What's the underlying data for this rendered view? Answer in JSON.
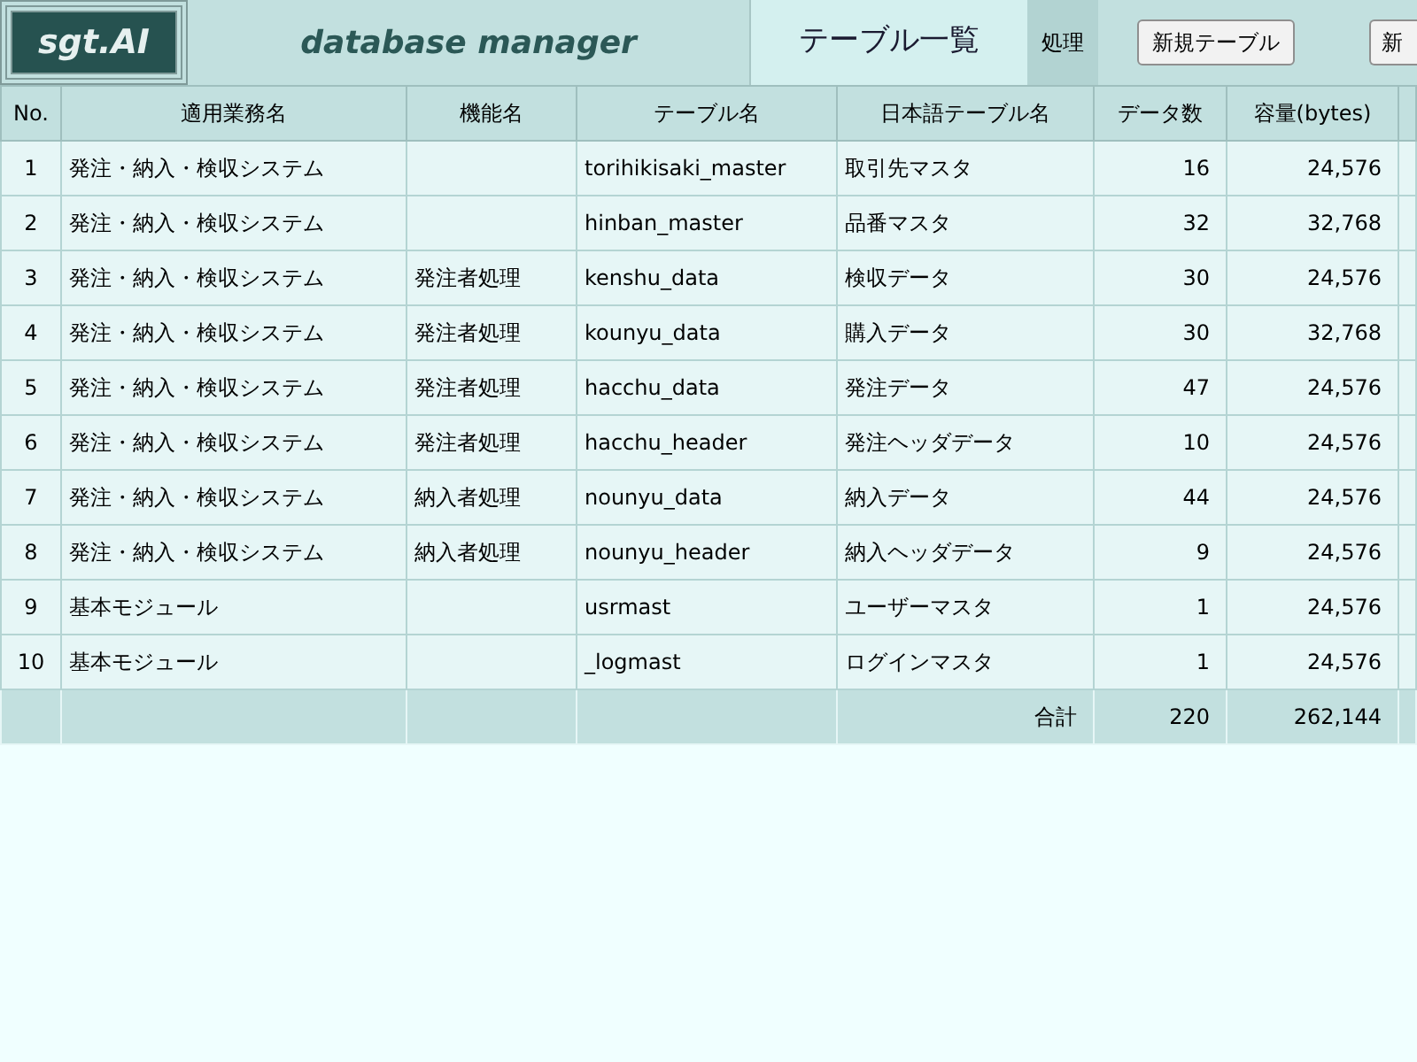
{
  "header": {
    "logo": "sgt.AI",
    "app_title": "database manager",
    "page_title": "テーブル一覧",
    "section_label": "処理",
    "buttons": [
      "新規テーブル",
      "新"
    ]
  },
  "table": {
    "columns": [
      "No.",
      "適用業務名",
      "機能名",
      "テーブル名",
      "日本語テーブル名",
      "データ数",
      "容量(bytes)"
    ],
    "rows": [
      {
        "no": "1",
        "system": "発注・納入・検収システム",
        "table": "torihikisaki_master",
        "jp_name": "取引先マスタ",
        "count": "16",
        "size": "24,576"
      },
      {
        "no": "2",
        "system": "発注・納入・検収システム",
        "table": "hinban_master",
        "jp_name": "品番マスタ",
        "count": "32",
        "size": "32,768"
      },
      {
        "no": "3",
        "system": "発注・納入・検収システム",
        "function": "発注者処理",
        "table": "kenshu_data",
        "jp_name": "検収データ",
        "count": "30",
        "size": "24,576"
      },
      {
        "no": "4",
        "system": "発注・納入・検収システム",
        "function": "発注者処理",
        "table": "kounyu_data",
        "jp_name": "購入データ",
        "count": "30",
        "size": "32,768"
      },
      {
        "no": "5",
        "system": "発注・納入・検収システム",
        "function": "発注者処理",
        "table": "hacchu_data",
        "jp_name": "発注データ",
        "count": "47",
        "size": "24,576"
      },
      {
        "no": "6",
        "system": "発注・納入・検収システム",
        "function": "発注者処理",
        "table": "hacchu_header",
        "jp_name": "発注ヘッダデータ",
        "count": "10",
        "size": "24,576"
      },
      {
        "no": "7",
        "system": "発注・納入・検収システム",
        "function": "納入者処理",
        "table": "nounyu_data",
        "jp_name": "納入データ",
        "count": "44",
        "size": "24,576"
      },
      {
        "no": "8",
        "system": "発注・納入・検収システム",
        "function": "納入者処理",
        "table": "nounyu_header",
        "jp_name": "納入ヘッダデータ",
        "count": "9",
        "size": "24,576"
      },
      {
        "no": "9",
        "system": "基本モジュール",
        "table": "usrmast",
        "jp_name": "ユーザーマスタ",
        "count": "1",
        "size": "24,576"
      },
      {
        "no": "10",
        "system": "基本モジュール",
        "table": "_logmast",
        "jp_name": "ログインマスタ",
        "count": "1",
        "size": "24,576"
      }
    ],
    "total": {
      "label": "合計",
      "count": "220",
      "size": "262,144"
    }
  }
}
